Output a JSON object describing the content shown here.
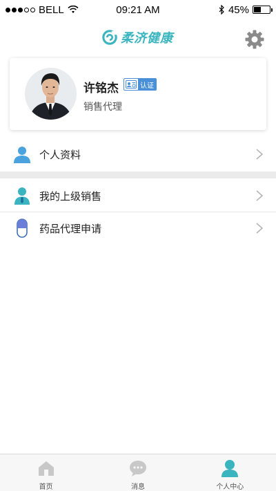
{
  "status_bar": {
    "carrier": "BELL",
    "time": "09:21 AM",
    "battery": "45%",
    "battery_level": 0.45
  },
  "header": {
    "brand": "柔济健康",
    "brand_color": "#3ab5c0",
    "settings_icon": "gear-icon"
  },
  "profile": {
    "name": "许铭杰",
    "badge": "认证",
    "role": "销售代理"
  },
  "menu": [
    {
      "label": "个人资料",
      "icon": "person-icon"
    },
    {
      "label": "我的上级销售",
      "icon": "salesperson-icon"
    },
    {
      "label": "药品代理申请",
      "icon": "capsule-icon"
    }
  ],
  "tabs": [
    {
      "label": "首页",
      "icon": "home-icon"
    },
    {
      "label": "消息",
      "icon": "message-icon"
    },
    {
      "label": "个人中心",
      "icon": "user-icon",
      "active": true
    }
  ],
  "colors": {
    "accent": "#3ab5c0",
    "badge": "#4a90d9",
    "tab_inactive": "#c8c8c8"
  }
}
